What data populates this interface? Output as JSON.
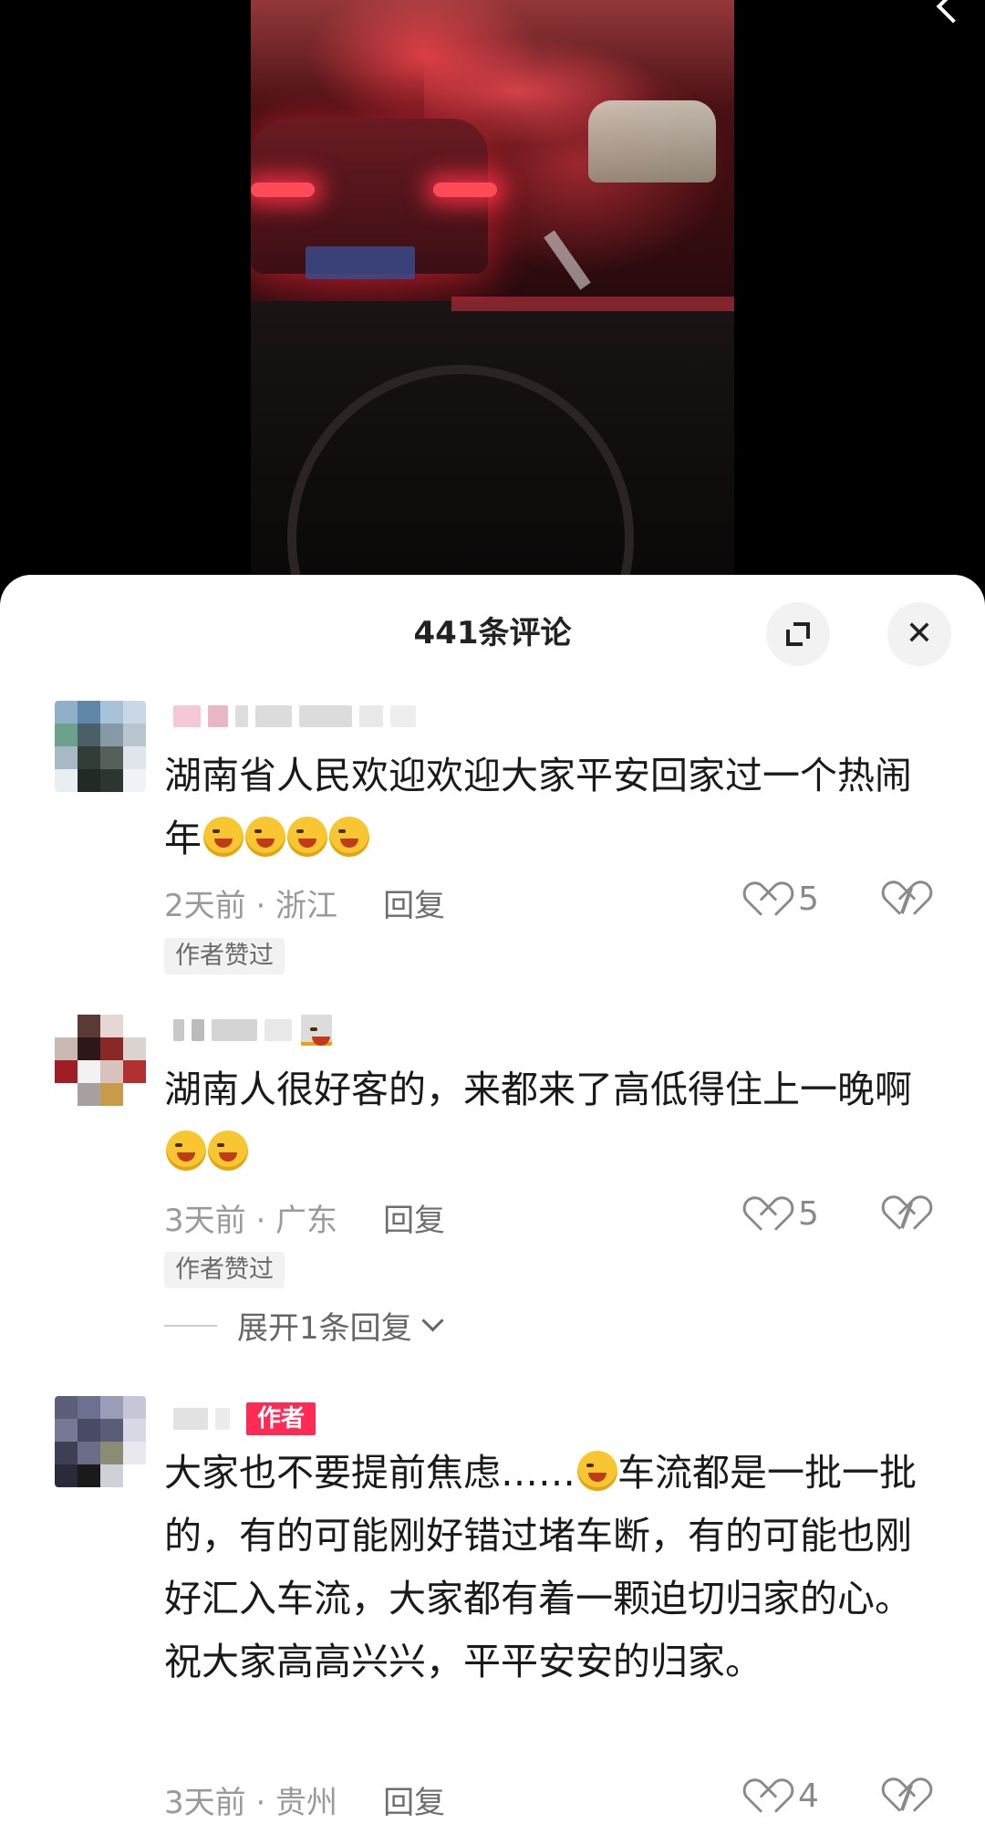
{
  "video": {
    "description_icon": "back-arrow-icon"
  },
  "header": {
    "comment_count": "441条评论",
    "expand_icon": "fullscreen-icon",
    "close_label": "✕"
  },
  "comments": [
    {
      "text": "湖南省人民欢迎欢迎大家平安回家过一个热闹年",
      "emoji_count": 4,
      "time_location": "2天前 · 浙江",
      "reply_label": "回复",
      "likes": "5",
      "author_liked": "作者赞过"
    },
    {
      "text": "湖南人很好客的，来都来了高低得住上一晚啊",
      "emoji_count": 2,
      "time_location": "3天前 · 广东",
      "reply_label": "回复",
      "likes": "5",
      "author_liked": "作者赞过",
      "expand_replies": "展开1条回复"
    },
    {
      "author_tag": "作者",
      "text_part1": "大家也不要提前焦虑……",
      "text_part2": "车流都是一批一批的，有的可能刚好错过堵车断，有的可能也刚好汇入车流，大家都有着一颗迫切归家的心。祝大家高高兴兴，平平安安的归家。",
      "time_location": "3天前 · 贵州",
      "reply_label": "回复",
      "likes": "4"
    }
  ],
  "colors": {
    "author_tag": "#fe2c55",
    "meta_gray": "#9a9a9a",
    "text": "#1a1a1a"
  }
}
